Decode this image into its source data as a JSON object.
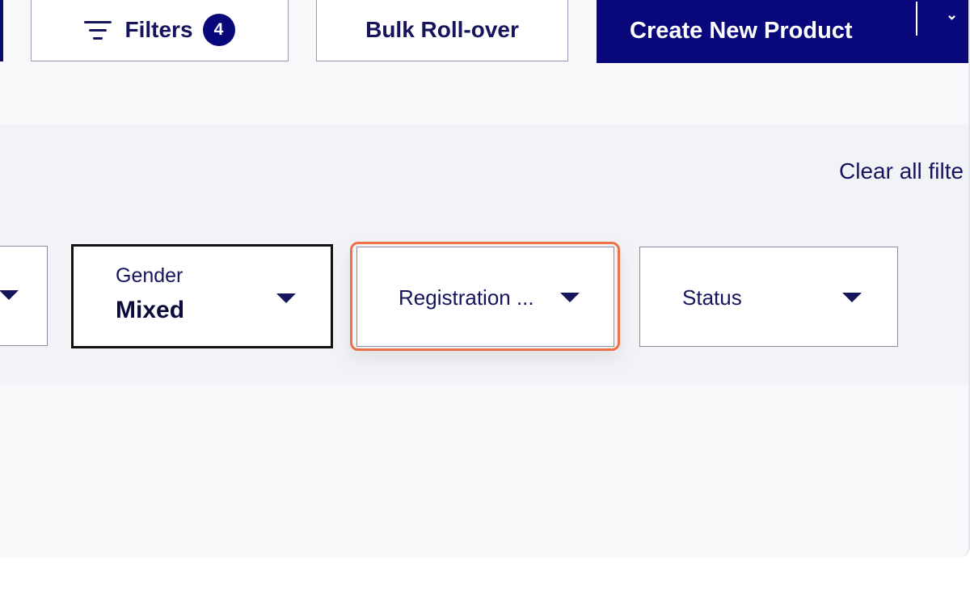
{
  "toolbar": {
    "filters_label": "Filters",
    "filters_count": "4",
    "bulk_rollover_label": "Bulk Roll-over",
    "create_product_label": "Create New Product"
  },
  "filters_panel": {
    "clear_all_label": "Clear all filte",
    "gender": {
      "label": "Gender",
      "value": "Mixed"
    },
    "registration": {
      "label": "Registration ..."
    },
    "status": {
      "label": "Status"
    }
  },
  "colors": {
    "brand_navy": "#08087a",
    "focus_ring": "#ef7047"
  }
}
